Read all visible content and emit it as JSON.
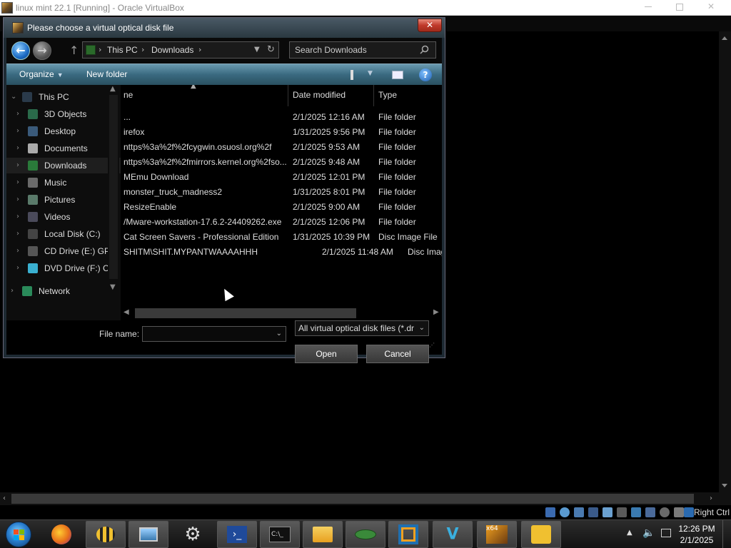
{
  "host": {
    "title": "linux mint 22.1 [Running] - Oracle VirtualBox",
    "right_ctrl": "Right Ctrl",
    "clock_time": "12:26 PM",
    "clock_date": "2/1/2025"
  },
  "dialog": {
    "title": "Please choose a virtual optical disk file",
    "close_glyph": "✕",
    "address": {
      "crumbs": [
        "This PC",
        "Downloads"
      ],
      "separator": "›"
    },
    "search_placeholder": "Search Downloads",
    "command_bar": {
      "organize": "Organize",
      "new_folder": "New folder",
      "help": "?"
    },
    "nav_pane": [
      {
        "label": "This PC",
        "icon": "computer-icon",
        "color": "#2a3a4a"
      },
      {
        "label": "3D Objects",
        "icon": "cube-icon",
        "color": "#2a6a4a"
      },
      {
        "label": "Desktop",
        "icon": "desktop-icon",
        "color": "#3a5a7a"
      },
      {
        "label": "Documents",
        "icon": "document-icon",
        "color": "#aaaaaa"
      },
      {
        "label": "Downloads",
        "icon": "download-icon",
        "color": "#2a7a3a"
      },
      {
        "label": "Music",
        "icon": "music-icon",
        "color": "#6a6a6a"
      },
      {
        "label": "Pictures",
        "icon": "pictures-icon",
        "color": "#5a7a6a"
      },
      {
        "label": "Videos",
        "icon": "video-icon",
        "color": "#4a4a5a"
      },
      {
        "label": "Local Disk (C:)",
        "icon": "drive-icon",
        "color": "#444444"
      },
      {
        "label": "CD Drive (E:) GP",
        "icon": "cd-drive-icon",
        "color": "#555555"
      },
      {
        "label": "DVD Drive (F:) C",
        "icon": "dvd-drive-icon",
        "color": "#3ab0d0"
      },
      {
        "label": "Network",
        "icon": "network-icon",
        "color": "#2a8a5a"
      }
    ],
    "columns": {
      "name": "ne",
      "date": "Date modified",
      "type": "Type"
    },
    "files": [
      {
        "name": "...",
        "date": "2/1/2025 12:16 AM",
        "type": "File folder"
      },
      {
        "name": "irefox",
        "date": "1/31/2025 9:56 PM",
        "type": "File folder"
      },
      {
        "name": "nttps%3a%2f%2fcygwin.osuosl.org%2f",
        "date": "2/1/2025 9:53 AM",
        "type": "File folder"
      },
      {
        "name": "nttps%3a%2f%2fmirrors.kernel.org%2fso...",
        "date": "2/1/2025 9:48 AM",
        "type": "File folder"
      },
      {
        "name": "MEmu Download",
        "date": "2/1/2025 12:01 PM",
        "type": "File folder"
      },
      {
        "name": "monster_truck_madness2",
        "date": "1/31/2025 8:01 PM",
        "type": "File folder"
      },
      {
        "name": "ResizeEnable",
        "date": "2/1/2025 9:00 AM",
        "type": "File folder"
      },
      {
        "name": "/Mware-workstation-17.6.2-24409262.exe",
        "date": "2/1/2025 12:06 PM",
        "type": "File folder"
      },
      {
        "name": "Cat Screen Savers - Professional Edition",
        "date": "1/31/2025 10:39 PM",
        "type": "Disc Image File"
      },
      {
        "name": "SHITM\\SHIT.MYPANTWAAAAHHH",
        "date": "2/1/2025 11:48 AM",
        "type": "Disc Imag"
      }
    ],
    "file_name_label": "File name:",
    "file_name_value": "",
    "filter": "All virtual optical disk files (*.dr",
    "open_label": "Open",
    "cancel_label": "Cancel"
  },
  "taskbar": {
    "apps": [
      {
        "name": "firefox",
        "color": "#e8701a"
      },
      {
        "name": "bee",
        "color": "#d8b040"
      },
      {
        "name": "computer",
        "color": "#4a7ab0"
      },
      {
        "name": "settings",
        "color": "#cfcfcf"
      },
      {
        "name": "powershell",
        "color": "#1f4a9a"
      },
      {
        "name": "terminal",
        "color": "#111111"
      },
      {
        "name": "file-explorer",
        "color": "#e8b830"
      },
      {
        "name": "vm-tool",
        "color": "#3a7a3a"
      },
      {
        "name": "virtualbox",
        "color": "#1f6fb0"
      },
      {
        "name": "vmware",
        "color": "#3a8ac0"
      },
      {
        "name": "x64-app",
        "color": "#f0a020"
      },
      {
        "name": "puzzle-app",
        "color": "#f0c030"
      }
    ]
  },
  "colors": {
    "accent": "#3a6a80",
    "selected_bg": "#1e1e1e"
  }
}
